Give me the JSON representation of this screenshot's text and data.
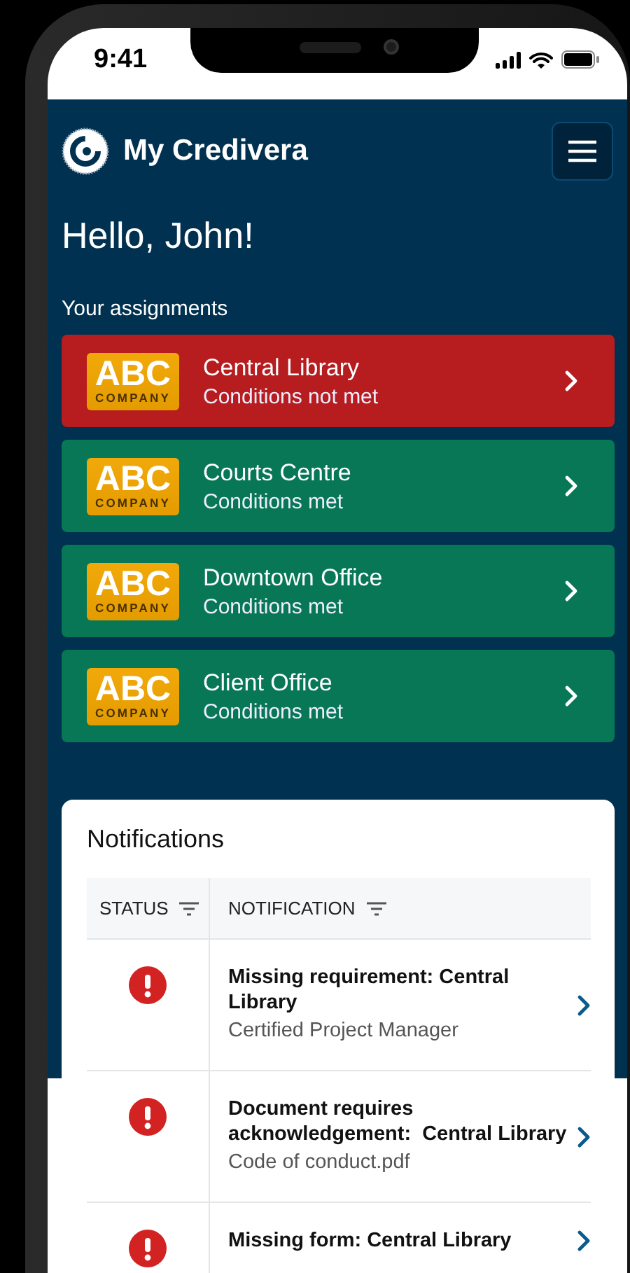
{
  "status_bar": {
    "time": "9:41"
  },
  "header": {
    "app_name": "My Credivera"
  },
  "greeting": "Hello, John!",
  "assignments_label": "Your assignments",
  "assignments": [
    {
      "logo_main": "ABC",
      "logo_sub": "COMPANY",
      "name": "Central Library",
      "status": "Conditions not met",
      "kind": "unmet"
    },
    {
      "logo_main": "ABC",
      "logo_sub": "COMPANY",
      "name": "Courts Centre",
      "status": "Conditions met",
      "kind": "met"
    },
    {
      "logo_main": "ABC",
      "logo_sub": "COMPANY",
      "name": "Downtown Office",
      "status": "Conditions met",
      "kind": "met"
    },
    {
      "logo_main": "ABC",
      "logo_sub": "COMPANY",
      "name": "Client Office",
      "status": "Conditions met",
      "kind": "met"
    }
  ],
  "notifications": {
    "title": "Notifications",
    "columns": [
      "STATUS",
      "NOTIFICATION"
    ],
    "rows": [
      {
        "kind": "error",
        "title": "Missing requirement: Central Library",
        "detail": "Certified Project Manager"
      },
      {
        "kind": "error",
        "title": "Document requires acknowledgement:  Central Library",
        "detail": "Code of conduct.pdf"
      },
      {
        "kind": "error",
        "title": "Missing form: Central Library"
      }
    ]
  }
}
